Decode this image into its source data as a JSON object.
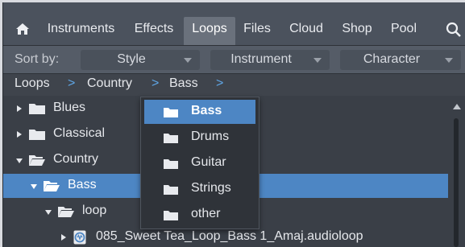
{
  "nav": {
    "home_icon": "home-icon",
    "tabs": [
      {
        "label": "Instruments",
        "active": false
      },
      {
        "label": "Effects",
        "active": false
      },
      {
        "label": "Loops",
        "active": true
      },
      {
        "label": "Files",
        "active": false
      },
      {
        "label": "Cloud",
        "active": false
      },
      {
        "label": "Shop",
        "active": false
      },
      {
        "label": "Pool",
        "active": false
      }
    ],
    "search_icon": "search-icon"
  },
  "sort": {
    "label": "Sort by:",
    "selects": [
      "Style",
      "Instrument",
      "Character"
    ]
  },
  "breadcrumb": {
    "items": [
      "Loops",
      "Country",
      "Bass"
    ],
    "separator": ">"
  },
  "tree": {
    "rows": [
      {
        "label": "Blues",
        "expanded": false,
        "selected": false,
        "icon": "folder-icon"
      },
      {
        "label": "Classical",
        "expanded": false,
        "selected": false,
        "icon": "folder-icon"
      },
      {
        "label": "Country",
        "expanded": true,
        "selected": false,
        "icon": "folder-open-icon"
      },
      {
        "label": "Bass",
        "expanded": true,
        "selected": true,
        "icon": "folder-open-icon"
      },
      {
        "label": "loop",
        "expanded": true,
        "selected": false,
        "icon": "folder-open-icon"
      },
      {
        "label": "085_Sweet Tea_Loop_Bass 1_Amaj.audioloop",
        "expanded": false,
        "selected": false,
        "icon": "audioloop-file-icon"
      }
    ]
  },
  "dropdown": {
    "items": [
      {
        "label": "Bass",
        "selected": true
      },
      {
        "label": "Drums",
        "selected": false
      },
      {
        "label": "Guitar",
        "selected": false
      },
      {
        "label": "Strings",
        "selected": false
      },
      {
        "label": "other",
        "selected": false
      }
    ]
  },
  "colors": {
    "accent": "#4d86c4",
    "breadcrumb_separator": "#5fa6e6",
    "panel": "#3a3f47"
  }
}
